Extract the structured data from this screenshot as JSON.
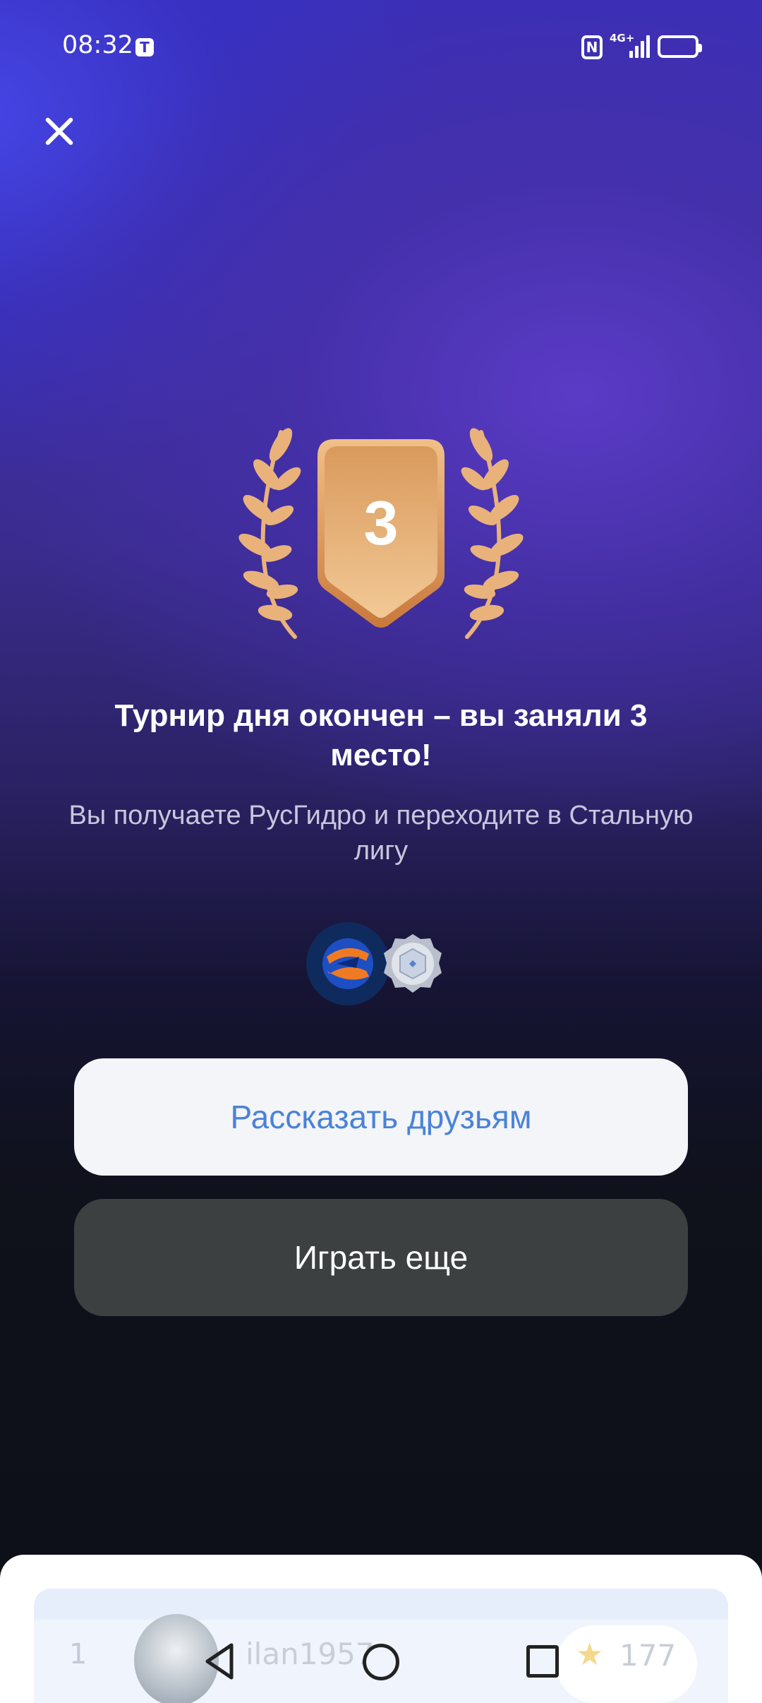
{
  "status_bar": {
    "time": "08:32",
    "t_icon": "Т",
    "nfc_icon": "N",
    "network": "4G+"
  },
  "close_icon": "close-icon",
  "badge": {
    "place_number": "3",
    "colors": {
      "shield_top": "#e8b47c",
      "shield_bottom": "#d8904e",
      "laurel": "#e9b27a"
    }
  },
  "title": "Турнир дня окончен – вы заняли 3 место!",
  "subtitle": "Вы получаете РусГидро и переходите в Стальную лигу",
  "rewards": {
    "company_logo": "rushydro-logo-icon",
    "league_badge": "steel-league-badge-icon"
  },
  "buttons": {
    "share": "Рассказать друзьям",
    "play_again": "Играть еще"
  },
  "leaderboard_row": {
    "rank": "1",
    "name": "ilan1957",
    "score": "177",
    "score_icon": "star-icon"
  },
  "nav_bar": {
    "back_icon": "back-icon",
    "home_icon": "home-icon",
    "recent_icon": "recent-apps-icon"
  },
  "accent_colors": {
    "share_text": "#4a82d8",
    "share_bg": "#f3f5f8",
    "play_bg": "#3c4041"
  }
}
